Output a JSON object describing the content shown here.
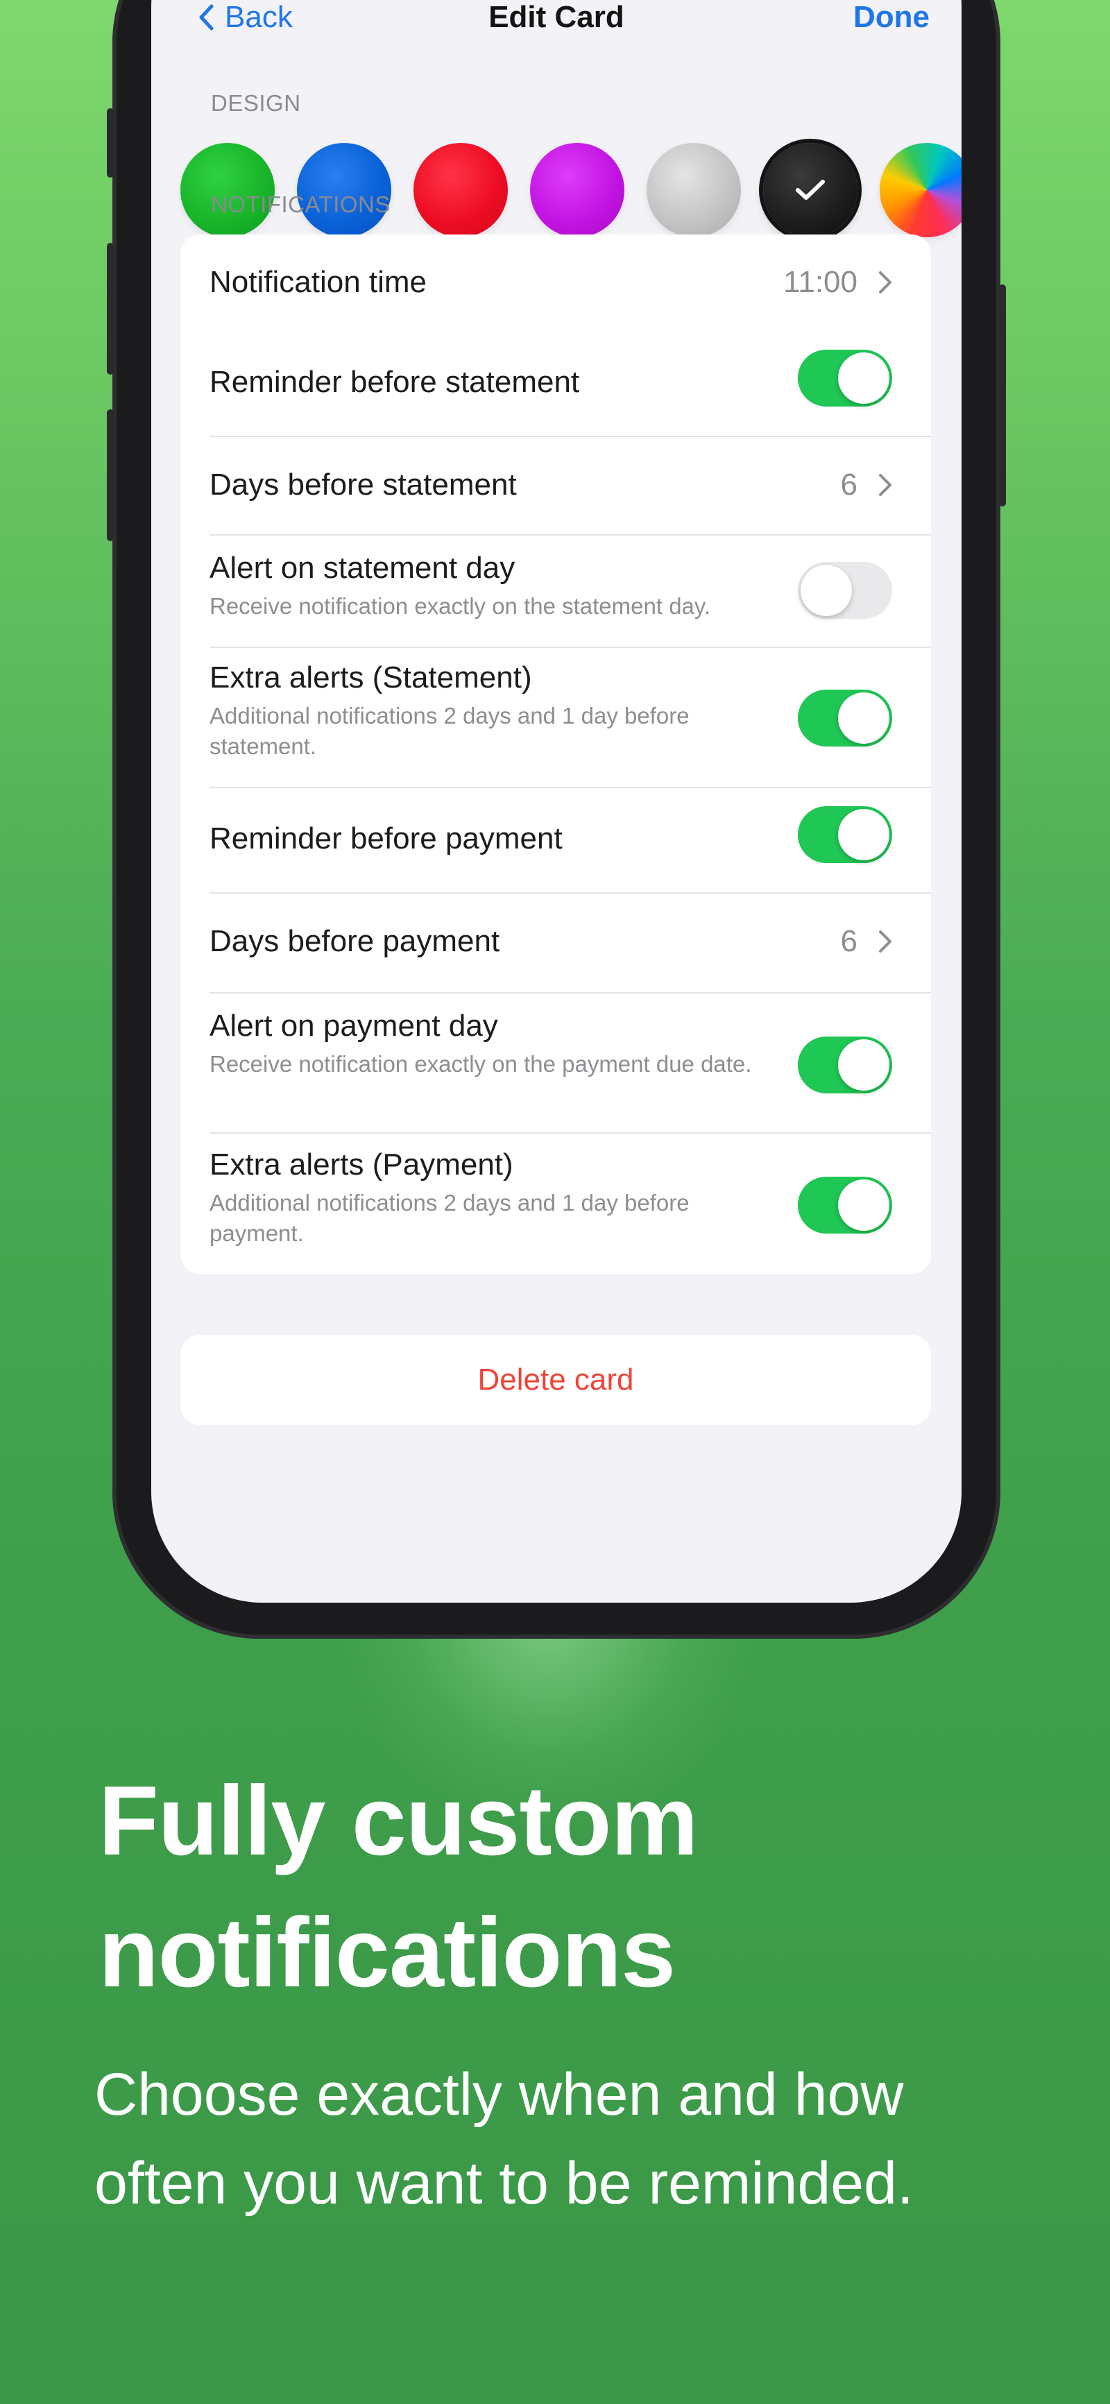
{
  "nav": {
    "back_label": "Back",
    "title": "Edit Card",
    "done_label": "Done"
  },
  "design": {
    "header": "DESIGN",
    "swatches": [
      {
        "name": "green",
        "color": "#19b52a",
        "selected": false
      },
      {
        "name": "blue",
        "color": "#0a62d8",
        "selected": false
      },
      {
        "name": "red",
        "color": "#ee0d24",
        "selected": false
      },
      {
        "name": "purple",
        "color": "#c414e3",
        "selected": false
      },
      {
        "name": "silver",
        "color": "#c4c4c4",
        "selected": true
      },
      {
        "name": "black",
        "color": "#1c1c1c",
        "selected": true
      },
      {
        "name": "rainbow",
        "color": "multicolor",
        "selected": false
      }
    ]
  },
  "notifications": {
    "header": "NOTIFICATIONS",
    "notification_time": {
      "label": "Notification time",
      "value": "11:00"
    },
    "reminder_before_statement": {
      "label": "Reminder before statement",
      "on": true
    },
    "days_before_statement": {
      "label": "Days before statement",
      "value": "6"
    },
    "alert_on_statement_day": {
      "label": "Alert on statement day",
      "description": "Receive notification exactly on the statement day.",
      "on": false
    },
    "extra_alerts_statement": {
      "label": "Extra alerts (Statement)",
      "description": "Additional notifications 2 days and 1 day before statement.",
      "on": true
    },
    "reminder_before_payment": {
      "label": "Reminder before payment",
      "on": true
    },
    "days_before_payment": {
      "label": "Days before payment",
      "value": "6"
    },
    "alert_on_payment_day": {
      "label": "Alert on payment day",
      "description": "Receive notification exactly on the payment due date.",
      "on": true
    },
    "extra_alerts_payment": {
      "label": "Extra alerts (Payment)",
      "description": "Additional notifications 2 days and 1 day before payment.",
      "on": true
    }
  },
  "delete_label": "Delete card",
  "marketing": {
    "headline_line1": "Fully custom",
    "headline_line2": "notifications",
    "subtext": "Choose exactly when and how often you want to be reminded."
  },
  "colors": {
    "accent_blue": "#1f76e8",
    "toggle_on": "#1fc755",
    "destructive": "#f0443a",
    "background_green": "#4bab55"
  }
}
